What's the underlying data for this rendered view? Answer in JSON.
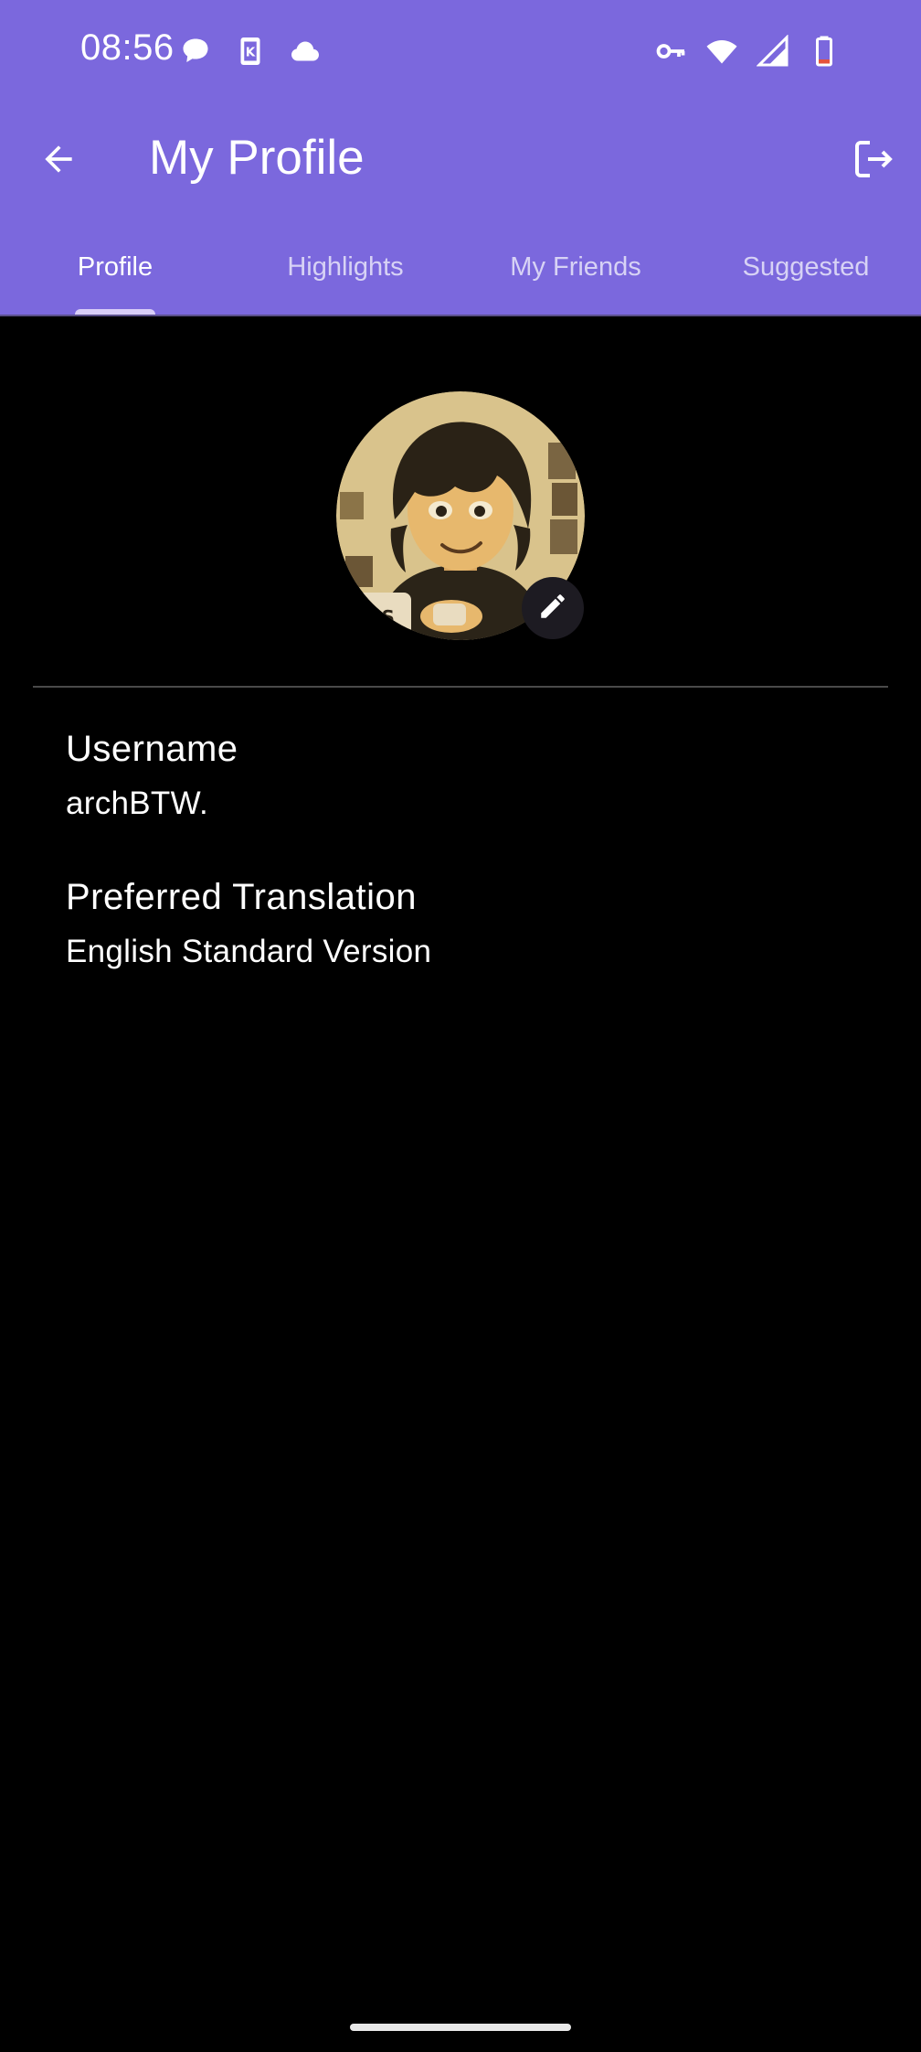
{
  "status_bar": {
    "time": "08:56",
    "left_icons": [
      "chat-bubble-icon",
      "keyboard-k-icon",
      "cloud-icon"
    ],
    "right_icons": [
      "vpn-key-icon",
      "wifi-icon",
      "cell-signal-icon",
      "battery-low-icon"
    ]
  },
  "toolbar": {
    "title": "My Profile",
    "back_icon": "arrow-left-icon",
    "logout_icon": "logout-icon"
  },
  "tabs": [
    {
      "label": "Profile",
      "active": true
    },
    {
      "label": "Highlights",
      "active": false
    },
    {
      "label": "My Friends",
      "active": false
    },
    {
      "label": "Suggested",
      "active": false
    }
  ],
  "profile": {
    "avatar_icon": "cartoon-avatar",
    "edit_icon": "pencil-icon",
    "fields": [
      {
        "label": "Username",
        "value": "archBTW."
      },
      {
        "label": "Preferred Translation",
        "value": "English Standard Version"
      }
    ]
  },
  "colors": {
    "app_bar": "#7B68DD",
    "background": "#000000",
    "tab_indicator": "#d8cdf7"
  }
}
